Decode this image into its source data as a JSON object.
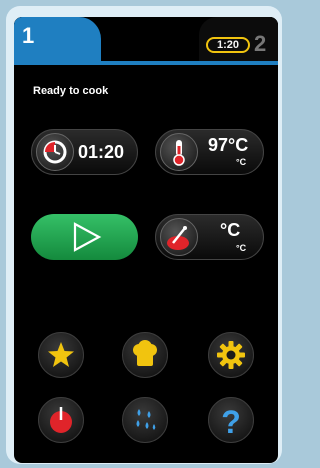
{
  "tabs": {
    "active_number": "1",
    "inactive_number": "2",
    "timer_badge": "1:20"
  },
  "status_text": "Ready to cook",
  "controls": {
    "time_value": "01:20",
    "temperature_value": "97°C",
    "temperature_unit": "°C",
    "core_temp_unit": "°C",
    "core_temp_unit_small": "°C"
  },
  "icons": {
    "time": "clock-icon",
    "temperature": "thermometer-icon",
    "start": "play-icon",
    "core_probe": "core-probe-icon",
    "favorites": "star-icon",
    "chef": "chef-hat-icon",
    "settings": "gear-icon",
    "power": "power-icon",
    "cleaning": "water-drops-icon",
    "help": "help-icon"
  },
  "colors": {
    "tab_blue": "#1f7fc1",
    "start_green": "#1fa84f",
    "accent_yellow": "#f1c40f",
    "accent_red": "#e0242a",
    "drop_blue": "#3fa0e8"
  }
}
